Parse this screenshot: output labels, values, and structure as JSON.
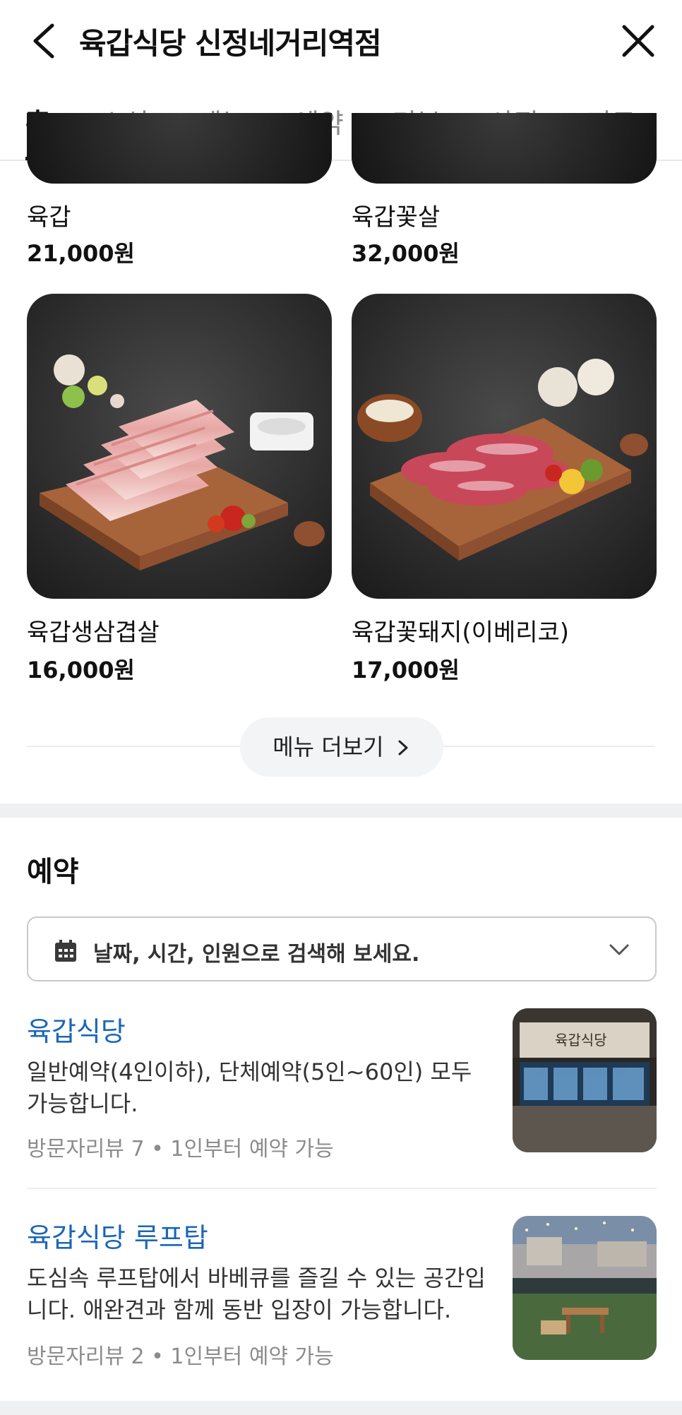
{
  "header": {
    "title": "육갑식당 신정네거리역점"
  },
  "tabs": [
    {
      "label": "홈"
    },
    {
      "label": "소식"
    },
    {
      "label": "메뉴"
    },
    {
      "label": "예약"
    },
    {
      "label": "리뷰"
    },
    {
      "label": "사진"
    },
    {
      "label": "지도"
    }
  ],
  "menu": {
    "items": [
      {
        "name": "육갑",
        "price": "21,000원"
      },
      {
        "name": "육갑꽃살",
        "price": "32,000원"
      },
      {
        "name": "육갑생삼겹살",
        "price": "16,000원"
      },
      {
        "name": "육갑꽃돼지(이베리코)",
        "price": "17,000원"
      }
    ],
    "more_label": "메뉴 더보기"
  },
  "reservation": {
    "title": "예약",
    "search_placeholder": "날짜, 시간, 인원으로 검색해 보세요.",
    "items": [
      {
        "name": "육갑식당",
        "description": "일반예약(4인이하), 단체예약(5인~60인) 모두 가능합니다.",
        "meta": "방문자리뷰 7 • 1인부터 예약 가능",
        "sign_text": "육갑식당"
      },
      {
        "name": "육갑식당 루프탑",
        "description": "도심속 루프탑에서 바베큐를 즐길 수 있는 공간입니다. 애완견과 함께 동반 입장이 가능합니다.",
        "meta": "방문자리뷰 2 • 1인부터 예약 가능"
      }
    ]
  },
  "icons": {
    "back": "chevron-left-icon",
    "close": "close-icon",
    "calendar": "calendar-icon",
    "chevron_down": "chevron-down-icon",
    "chevron_right": "chevron-right-icon"
  },
  "colors": {
    "link_blue": "#1a66b8",
    "text_primary": "#111111",
    "text_muted": "#8c8c8c",
    "tab_inactive": "#8a8a8a"
  }
}
